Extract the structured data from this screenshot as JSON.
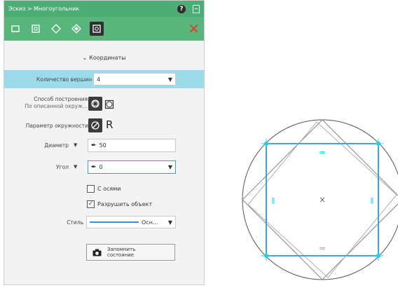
{
  "panel": {
    "title": "Эскиз > Многоугольник",
    "help_label": "?",
    "section_title": "Координаты",
    "vertex_count": {
      "label": "Количество вершин",
      "value": "4"
    },
    "construction": {
      "label_line1": "Способ построения",
      "label_line2": "По описанной окруж..."
    },
    "circle_param": {
      "label": "Параметр окружности",
      "radius_symbol": "R"
    },
    "diameter": {
      "label": "Диаметр",
      "value": "50"
    },
    "angle": {
      "label": "Угол",
      "value": "0"
    },
    "with_axes": {
      "label": "С осями",
      "checked": false
    },
    "destroy_object": {
      "label": "Разрушить объект",
      "checked": true
    },
    "style": {
      "label": "Стиль",
      "value": "Осн..."
    },
    "save_state": {
      "line1": "Запомнить",
      "line2": "состояние"
    },
    "close_label": "✕"
  },
  "drawing": {
    "circle_color": "#555555",
    "square_color": "#3aa0f0",
    "vertex_color": "#19d1f0",
    "equal_mark": "=",
    "parallel_mark": "ǁ",
    "center_mark": "×"
  }
}
